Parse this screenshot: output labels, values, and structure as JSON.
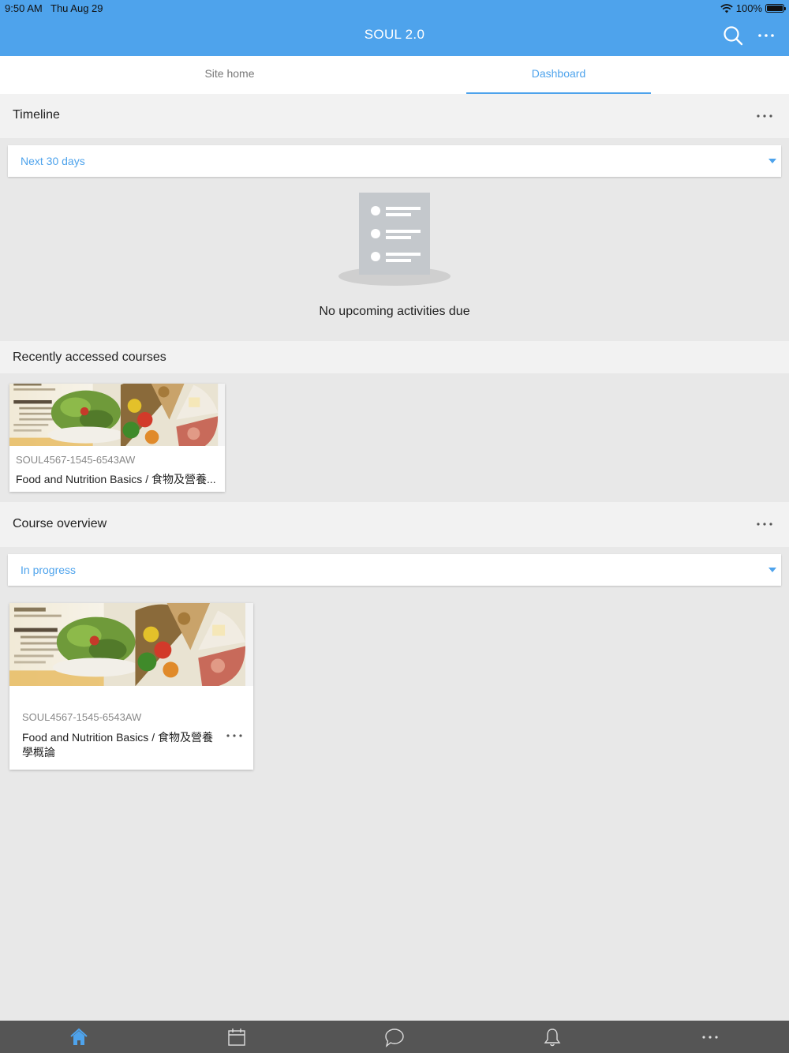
{
  "status_bar": {
    "time": "9:50 AM",
    "date": "Thu Aug 29",
    "battery": "100%"
  },
  "header": {
    "title": "SOUL 2.0",
    "search_icon": "search-icon",
    "more_icon": "more-icon"
  },
  "tabs": [
    {
      "label": "Site home",
      "active": false
    },
    {
      "label": "Dashboard",
      "active": true
    }
  ],
  "timeline": {
    "title": "Timeline",
    "filter": "Next 30 days",
    "empty_message": "No upcoming activities due"
  },
  "recent_courses": {
    "title": "Recently accessed courses",
    "items": [
      {
        "code": "SOUL4567-1545-6543AW",
        "name": "Food and Nutrition Basics / 食物及營養..."
      }
    ]
  },
  "course_overview": {
    "title": "Course overview",
    "filter": "In progress",
    "items": [
      {
        "code": "SOUL4567-1545-6543AW",
        "name_line1": "Food and Nutrition Basics / 食物及營養",
        "name_line2": "學概論"
      }
    ]
  },
  "bottom_nav": [
    {
      "icon": "home-icon",
      "active": true
    },
    {
      "icon": "calendar-icon",
      "active": false
    },
    {
      "icon": "messages-icon",
      "active": false
    },
    {
      "icon": "notifications-icon",
      "active": false
    },
    {
      "icon": "more-icon",
      "active": false
    }
  ],
  "colors": {
    "accent": "#4ea3ec",
    "header_bg": "#4ea3ec",
    "nav_bg": "#555555",
    "page_bg": "#e8e8e8"
  }
}
